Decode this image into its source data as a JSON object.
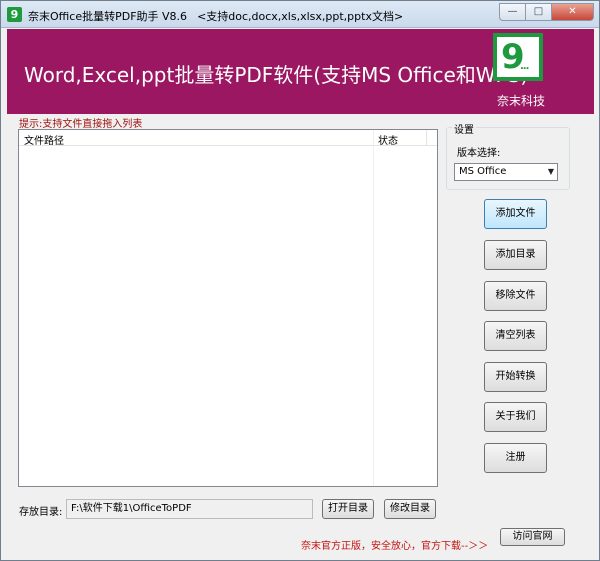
{
  "titlebar": {
    "icon_text": "9",
    "title": "奈末Office批量转PDF助手 V8.6",
    "subtitle": "<支持doc,docx,xls,xlsx,ppt,pptx文档>",
    "minimize": "—",
    "maximize": "□",
    "close": "✕"
  },
  "banner": {
    "headline": "Word,Excel,ppt批量转PDF软件(支持MS Office和WPS)",
    "logo_text": "9",
    "logo_dots": "...",
    "company": "奈末科技",
    "color": "#9b1762"
  },
  "hint": "提示:支持文件直接拖入列表",
  "file_list": {
    "columns": [
      "文件路径",
      "状态"
    ],
    "rows": []
  },
  "settings": {
    "title": "设置",
    "version_label": "版本选择:",
    "version_value": "MS Office"
  },
  "buttons": {
    "add_file": "添加文件",
    "add_dir": "添加目录",
    "remove_file": "移除文件",
    "clear_list": "清空列表",
    "start": "开始转换",
    "about": "关于我们",
    "register": "注册"
  },
  "output": {
    "label": "存放目录:",
    "path": "F:\\软件下载1\\OfficeToPDF",
    "open_dir": "打开目录",
    "change_dir": "修改目录"
  },
  "footer": {
    "promo": "奈末官方正版，安全放心，官方下载--＞＞",
    "visit": "访问官网"
  }
}
